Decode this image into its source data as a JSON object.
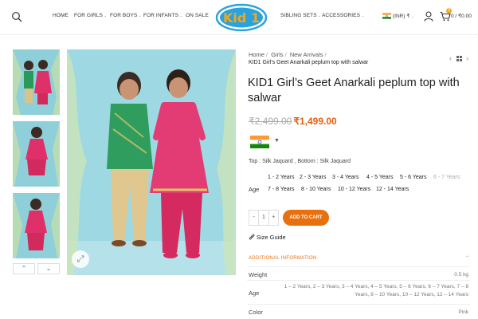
{
  "header": {
    "nav_left": [
      {
        "label": "HOME",
        "caret": false
      },
      {
        "label": "FOR GIRLS",
        "caret": true
      },
      {
        "label": "FOR BOYS",
        "caret": true
      },
      {
        "label": "FOR INFANTS",
        "caret": true
      },
      {
        "label": "ON SALE",
        "caret": false
      }
    ],
    "logo_text": "Kid 1",
    "nav_right": [
      {
        "label": "SIBLING SETS",
        "caret": true
      },
      {
        "label": "ACCESSORIES",
        "caret": true
      }
    ],
    "currency": "(INR) ₹",
    "cart_count": "0",
    "cart_total": "₹0.00"
  },
  "breadcrumb": {
    "items": [
      "Home",
      "Girls",
      "New Arrivals"
    ],
    "current": "KID1 Girl's Geet Anarkali peplum top with salwar"
  },
  "product": {
    "title": "KID1 Girl’s Geet Anarkali peplum top with salwar",
    "old_price": "₹2,499.00",
    "price": "₹1,499.00",
    "fabric": "Top : Silk Jaquard , Bottom : Silk Jaquard",
    "age_label": "Age",
    "ages": [
      {
        "label": "1 - 2 Years",
        "available": true
      },
      {
        "label": "2 - 3 Years",
        "available": true
      },
      {
        "label": "3 - 4 Years",
        "available": true
      },
      {
        "label": "4 - 5 Years",
        "available": true
      },
      {
        "label": "5 - 6 Years",
        "available": true
      },
      {
        "label": "6 - 7 Years",
        "available": false
      },
      {
        "label": "7 - 8 Years",
        "available": true
      },
      {
        "label": "8 - 10 Years",
        "available": true
      },
      {
        "label": "10 - 12 Years",
        "available": true
      },
      {
        "label": "12 - 14 Years",
        "available": true
      }
    ],
    "qty_minus": "-",
    "qty": "1",
    "qty_plus": "+",
    "add_to_cart": "ADD TO CART",
    "size_guide": "Size Guide"
  },
  "additional_info": {
    "heading": "ADDITIONAL INFORMATION",
    "rows": [
      {
        "key": "Weight",
        "value": "0.5 kg"
      },
      {
        "key": "Age",
        "value_line1": "1 – 2 Years, 2 – 3 Years, 3 – 4 Years, 4 – 5 Years, 5 – 6 Years, 6 – 7 Years, 7 – 8",
        "value_line2": "Years, 8 – 10 Years, 10 – 12 Years, 12 – 14 Years"
      },
      {
        "key": "Color",
        "value": "Pink"
      }
    ]
  },
  "colors": {
    "accent": "#e8700f",
    "price": "#e95d0e",
    "logo_blue": "#29a3de",
    "logo_orange": "#f7a61b"
  },
  "icons": {
    "search": "search-icon",
    "user": "user-icon",
    "cart": "cart-icon",
    "zoom": "expand-icon",
    "prev": "chevron-left-icon",
    "next": "chevron-right-icon",
    "grid": "grid-icon",
    "ruler": "ruler-icon"
  }
}
